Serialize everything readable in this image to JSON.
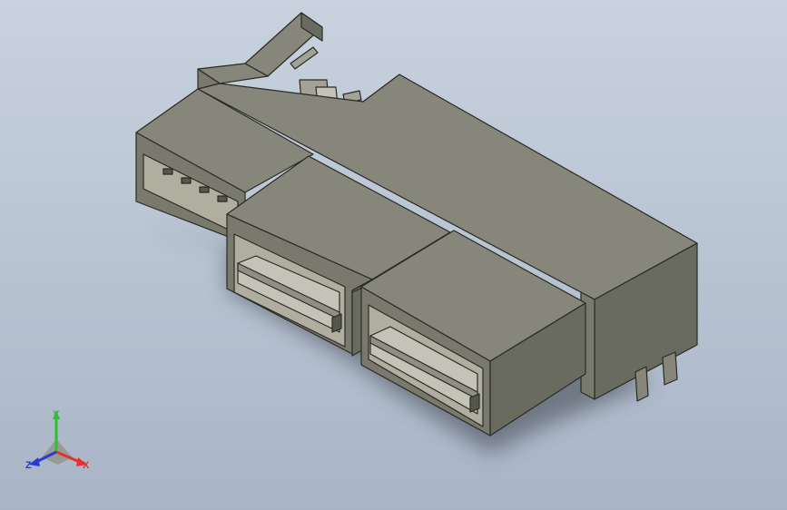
{
  "colors": {
    "background_top": "#c9d2de",
    "background_bottom": "#a9b5c6",
    "part_top": "#86867a",
    "part_front": "#797a6d",
    "part_side": "#6a6b5f",
    "part_dark": "#55564c",
    "cavity": "#b0ae9f",
    "edge": "#2a2a24",
    "shadow": "#3a3f48",
    "axis_x": "#e53030",
    "axis_y": "#2fbf2f",
    "axis_z": "#2a3ad6"
  },
  "model": {
    "name": "connector-3d-model",
    "icon": "usb-connector-assembly"
  },
  "triad": {
    "x_label": "X",
    "y_label": "Y",
    "z_label": "Z"
  }
}
